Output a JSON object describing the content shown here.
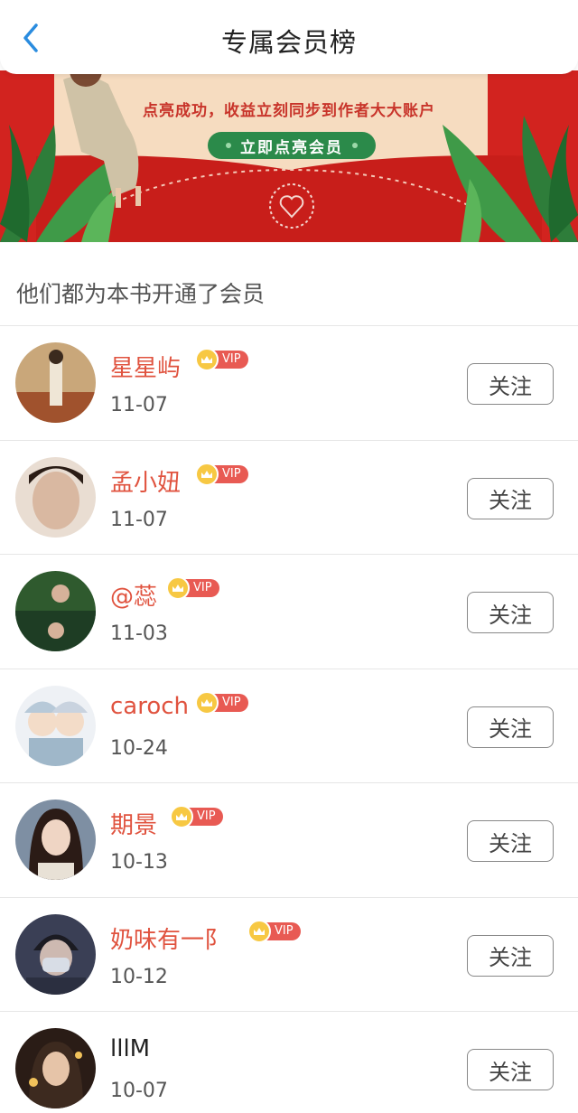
{
  "header": {
    "title": "专属会员榜"
  },
  "banner": {
    "text": "点亮成功，收益立刻同步到作者大大账户",
    "button_label": "立即点亮会员"
  },
  "section": {
    "title": "他们都为本书开通了会员"
  },
  "members": [
    {
      "name": "星星屿",
      "date": "11-07",
      "vip": true,
      "follow_label": "关注"
    },
    {
      "name": "孟小妞",
      "date": "11-07",
      "vip": true,
      "follow_label": "关注"
    },
    {
      "name": "@蕊",
      "date": "11-03",
      "vip": true,
      "follow_label": "关注"
    },
    {
      "name": "caroch",
      "date": "10-24",
      "vip": true,
      "follow_label": "关注"
    },
    {
      "name": "期景",
      "date": "10-13",
      "vip": true,
      "follow_label": "关注"
    },
    {
      "name": "奶味有一阝",
      "date": "10-12",
      "vip": true,
      "follow_label": "关注"
    },
    {
      "name": "lllM",
      "date": "10-07",
      "vip": false,
      "follow_label": "关注"
    }
  ],
  "vip_badge_label": "VIP",
  "colors": {
    "accent_name": "#e0533f",
    "vip_tag": "#e85a53",
    "banner_red": "#d2231f",
    "banner_green": "#2b8a4a",
    "back_arrow": "#2a8cdf"
  },
  "icons": {
    "back": "chevron-left-icon",
    "crown": "crown-icon",
    "heart": "heart-stamp-icon"
  }
}
